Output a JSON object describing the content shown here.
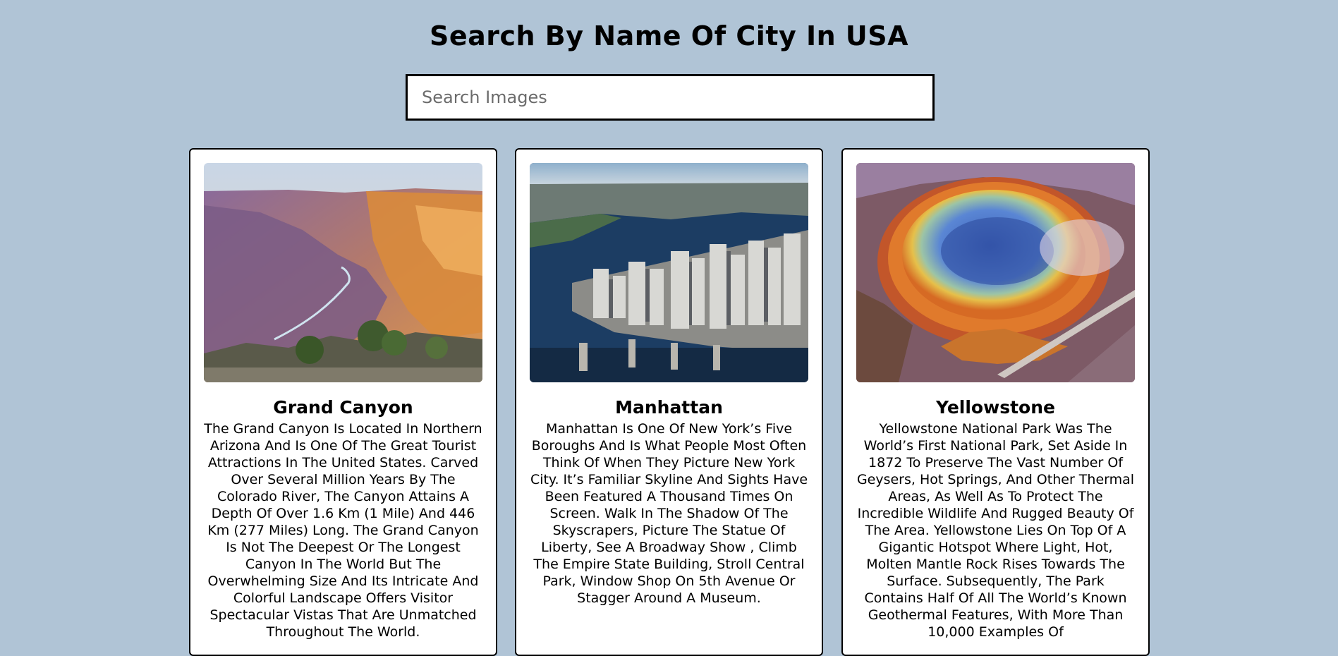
{
  "header": {
    "title": "Search By Name Of City In USA"
  },
  "search": {
    "placeholder": "Search Images",
    "value": ""
  },
  "cards": [
    {
      "title": "Grand Canyon",
      "image_icon": "canyon-photo",
      "description": "The Grand Canyon Is Located In Northern Arizona And Is One Of The Great Tourist Attractions In The United States. Carved Over Several Million Years By The Colorado River, The Canyon Attains A Depth Of Over 1.6 Km (1 Mile) And 446 Km (277 Miles) Long. The Grand Canyon Is Not The Deepest Or The Longest Canyon In The World But The Overwhelming Size And Its Intricate And Colorful Landscape Offers Visitor Spectacular Vistas That Are Unmatched Throughout The World."
    },
    {
      "title": "Manhattan",
      "image_icon": "skyline-photo",
      "description": "Manhattan Is One Of New York’s Five Boroughs And Is What People Most Often Think Of When They Picture New York City. It’s Familiar Skyline And Sights Have Been Featured A Thousand Times On Screen. Walk In The Shadow Of The Skyscrapers, Picture The Statue Of Liberty, See A Broadway Show , Climb The Empire State Building, Stroll Central Park, Window Shop On 5th Avenue Or Stagger Around A Museum."
    },
    {
      "title": "Yellowstone",
      "image_icon": "hot-spring-photo",
      "description": "Yellowstone National Park Was The World’s First National Park, Set Aside In 1872 To Preserve The Vast Number Of Geysers, Hot Springs, And Other Thermal Areas, As Well As To Protect The Incredible Wildlife And Rugged Beauty Of The Area. Yellowstone Lies On Top Of A Gigantic Hotspot Where Light, Hot, Molten Mantle Rock Rises Towards The Surface. Subsequently, The Park Contains Half Of All The World’s Known Geothermal Features, With More Than 10,000 Examples Of"
    }
  ]
}
